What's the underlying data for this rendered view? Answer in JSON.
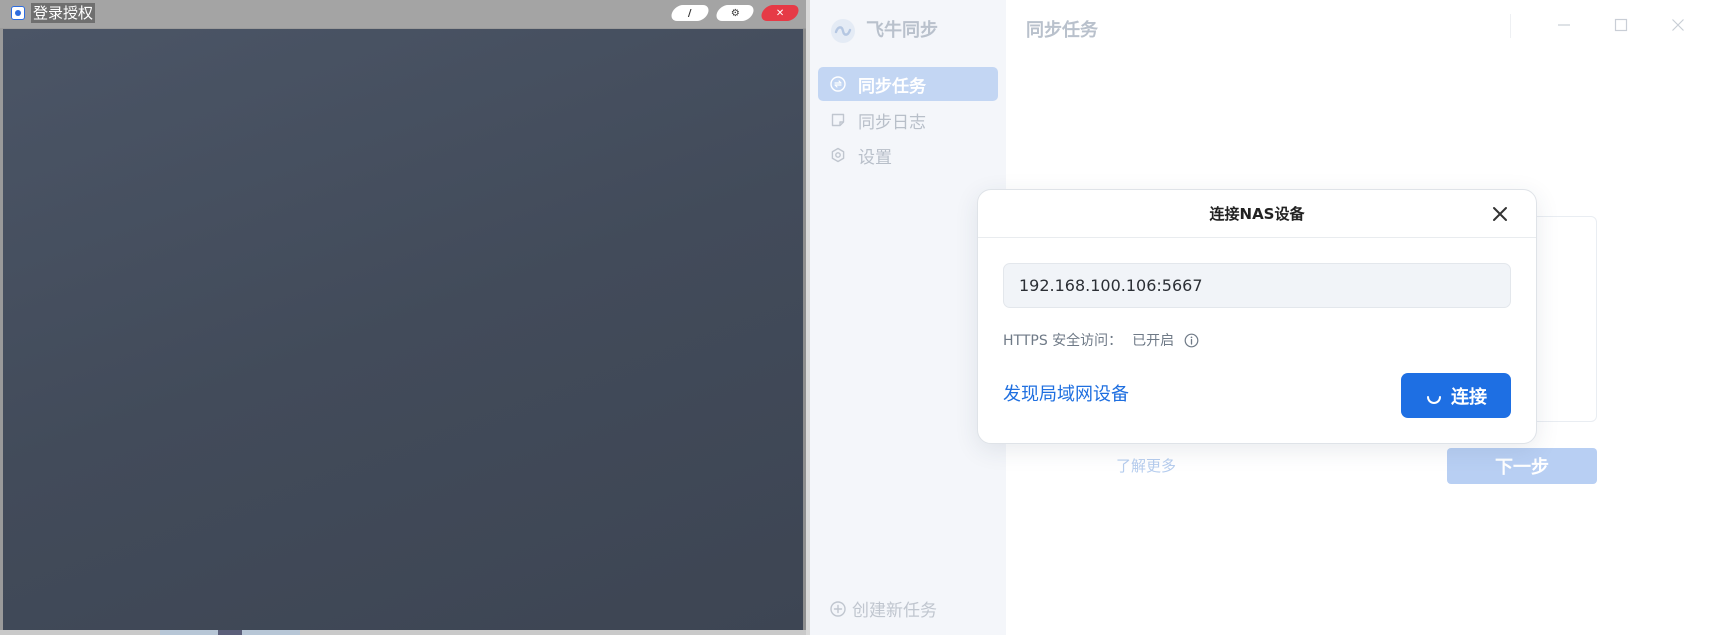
{
  "left_window": {
    "title": "登录授权",
    "buttons": {
      "minimize": "/",
      "settings": "⚙",
      "close": "✕"
    }
  },
  "app": {
    "brand": {
      "name": "飞牛同步"
    },
    "page_title": "同步任务",
    "sidebar": {
      "items": [
        {
          "label": "同步任务",
          "icon": "sync-icon",
          "active": true
        },
        {
          "label": "同步日志",
          "icon": "log-icon",
          "active": false
        },
        {
          "label": "设置",
          "icon": "gear-icon",
          "active": false
        }
      ],
      "create_task": "创建新任务"
    },
    "background": {
      "learn_more": "了解更多",
      "next_button": "下一步"
    },
    "modal": {
      "title": "连接NAS设备",
      "address_value": "192.168.100.106:5667",
      "https_label": "HTTPS 安全访问：",
      "https_status": "已开启",
      "discover_link": "发现局域网设备",
      "connect_button": "连接"
    }
  },
  "colors": {
    "accent": "#1e6fe3",
    "sidebar_active": "#c3d6f3",
    "left_window_body": "#454e5d",
    "close_red": "#e63a46"
  }
}
